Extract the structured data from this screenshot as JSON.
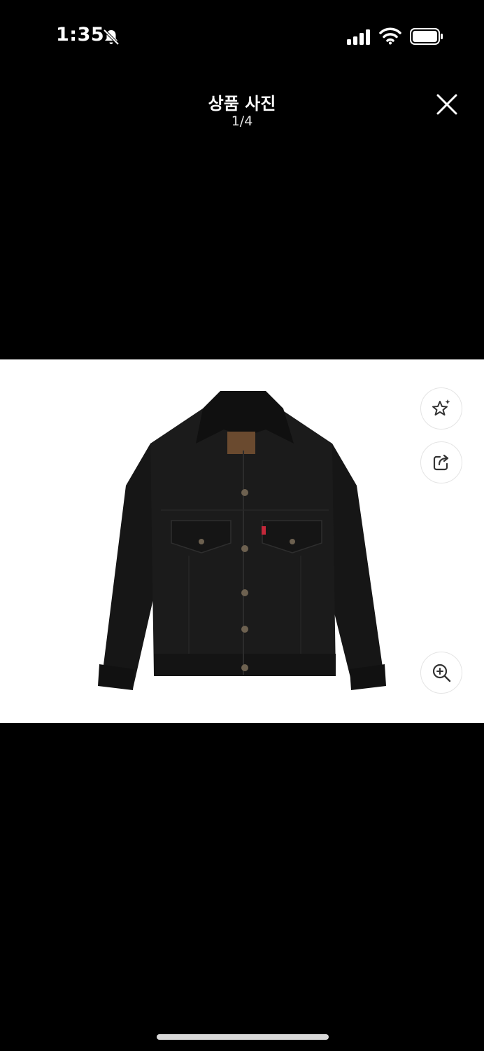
{
  "status_bar": {
    "time": "1:35"
  },
  "header": {
    "title": "상품 사진",
    "counter": "1/4"
  },
  "icons": {
    "bell_muted": "bell-slash-icon",
    "signal": "cellular-signal-icon",
    "wifi": "wifi-icon",
    "battery": "battery-icon",
    "close": "close-icon",
    "star": "star-sparkle-icon",
    "share": "share-icon",
    "zoom": "zoom-in-icon"
  },
  "colors": {
    "background": "#000000",
    "viewer_background": "#ffffff",
    "icon_dark": "#333333"
  }
}
